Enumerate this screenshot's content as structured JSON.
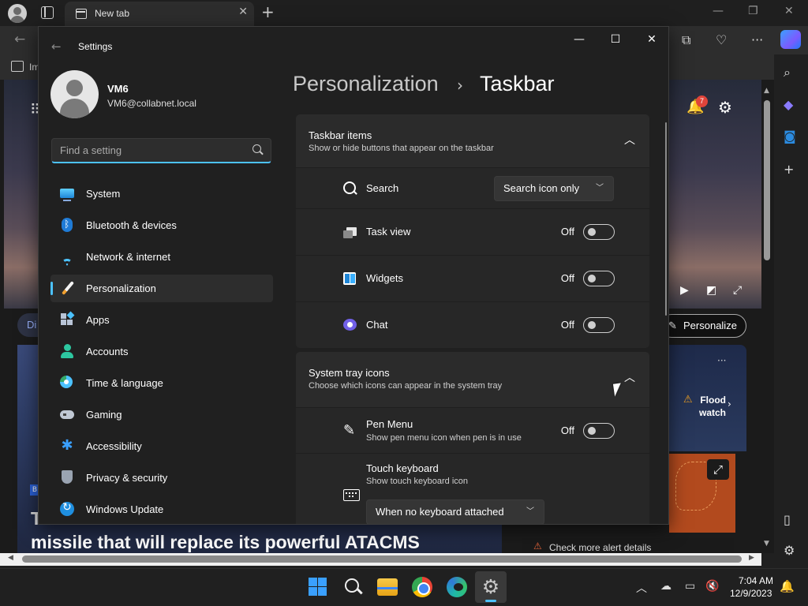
{
  "browser": {
    "tab_title": "New tab",
    "tab_close": "✕",
    "new_tab": "+",
    "favorites_text": "Im",
    "notification_count": "7",
    "discover_chip": "Di",
    "personalize_label": "Personalize",
    "news_badge": "B",
    "news_headline_line1": "T",
    "news_headline_line2": "missile that will replace its powerful ATACMS",
    "flood_watch": "Flood watch",
    "alert_text": "Check more alert details",
    "window_min": "—",
    "window_restore": "❐",
    "window_close": "✕"
  },
  "settings": {
    "window_title": "Settings",
    "back": "←",
    "min": "—",
    "max": "☐",
    "close": "✕",
    "user": {
      "name": "VM6",
      "email": "VM6@collabnet.local"
    },
    "search_placeholder": "Find a setting",
    "nav": [
      {
        "label": "System"
      },
      {
        "label": "Bluetooth & devices"
      },
      {
        "label": "Network & internet"
      },
      {
        "label": "Personalization"
      },
      {
        "label": "Apps"
      },
      {
        "label": "Accounts"
      },
      {
        "label": "Time & language"
      },
      {
        "label": "Gaming"
      },
      {
        "label": "Accessibility"
      },
      {
        "label": "Privacy & security"
      },
      {
        "label": "Windows Update"
      }
    ],
    "breadcrumb": {
      "parent": "Personalization",
      "separator": "›",
      "current": "Taskbar"
    },
    "taskbar_items": {
      "title": "Taskbar items",
      "subtitle": "Show or hide buttons that appear on the taskbar",
      "search": {
        "label": "Search",
        "value": "Search icon only"
      },
      "task_view": {
        "label": "Task view",
        "state": "Off"
      },
      "widgets": {
        "label": "Widgets",
        "state": "Off"
      },
      "chat": {
        "label": "Chat",
        "state": "Off"
      }
    },
    "system_tray": {
      "title": "System tray icons",
      "subtitle": "Choose which icons can appear in the system tray",
      "pen_menu": {
        "label": "Pen Menu",
        "sub": "Show pen menu icon when pen is in use",
        "state": "Off"
      },
      "touch_keyboard": {
        "label": "Touch keyboard",
        "sub": "Show touch keyboard icon",
        "value": "When no keyboard attached"
      }
    }
  },
  "taskbar": {
    "time": "7:04 AM",
    "date": "12/9/2023"
  },
  "colors": {
    "accent": "#4cc2ff",
    "window_bg": "#202020",
    "card_bg": "#272727"
  }
}
